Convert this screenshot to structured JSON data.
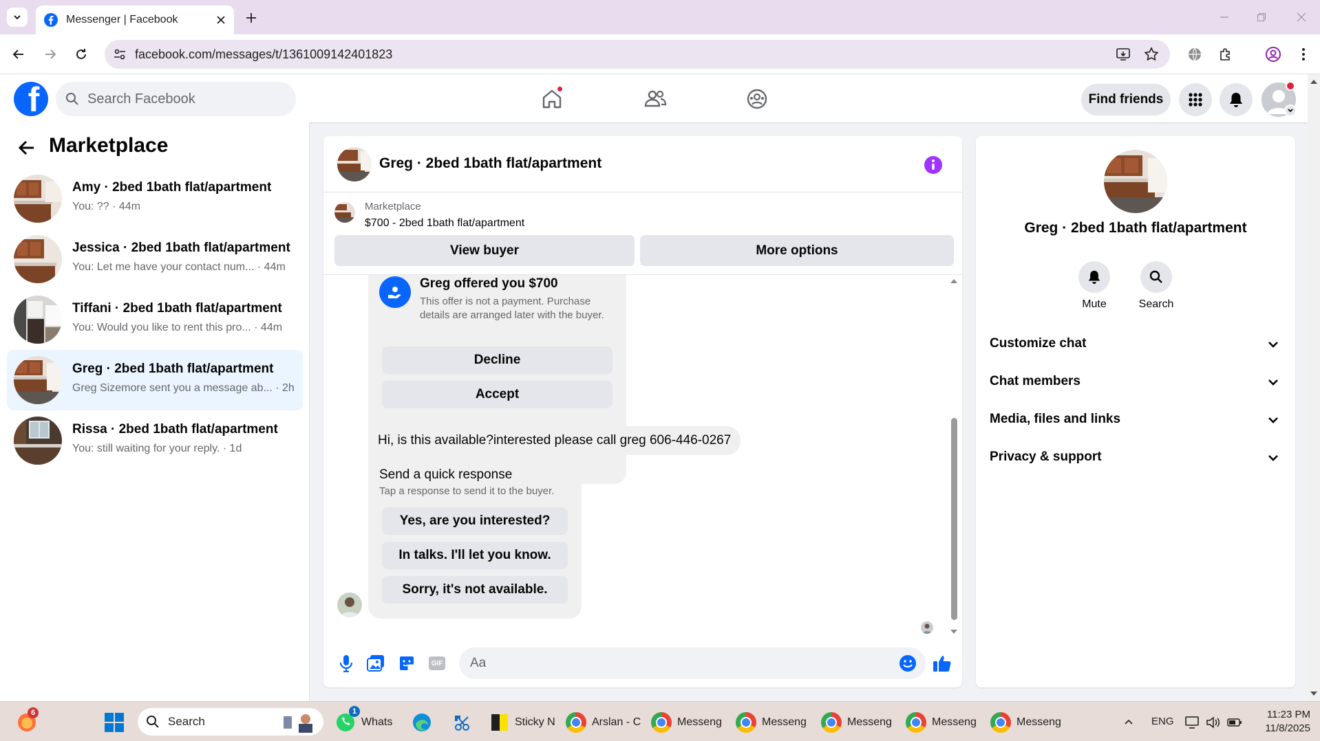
{
  "browser": {
    "tab_title": "Messenger | Facebook",
    "url": "facebook.com/messages/t/1361009142401823"
  },
  "header": {
    "search_placeholder": "Search Facebook",
    "find_friends_label": "Find friends"
  },
  "sidebar": {
    "title": "Marketplace",
    "conversations": [
      {
        "name": "Amy · 2bed 1bath flat/apartment",
        "preview": "You: ?? · 44m",
        "active": false
      },
      {
        "name": "Jessica · 2bed 1bath flat/apartment",
        "preview": "You: Let me have your contact num... · 44m",
        "active": false
      },
      {
        "name": "Tiffani · 2bed 1bath flat/apartment",
        "preview": "You: Would you like to rent this pro... · 44m",
        "active": false
      },
      {
        "name": "Greg · 2bed 1bath flat/apartment",
        "preview": "Greg Sizemore sent you a message ab... · 2h",
        "active": true
      },
      {
        "name": "Rissa · 2bed 1bath flat/apartment",
        "preview": "You: still waiting for your reply. · 1d",
        "active": false
      }
    ]
  },
  "chat": {
    "title": "Greg · 2bed 1bath flat/apartment",
    "listing_label": "Marketplace",
    "listing_price": "$700 - 2bed 1bath flat/apartment",
    "view_buyer_label": "View buyer",
    "more_options_label": "More options",
    "offer": {
      "title": "Greg offered you $700",
      "description": "This offer is not a payment. Purchase details are arranged later with the buyer.",
      "decline_label": "Decline",
      "accept_label": "Accept"
    },
    "message_text": "Hi, is this available?interested please call greg 606-446-0267",
    "quick_response": {
      "title": "Send a quick response",
      "subtitle": "Tap a response to send it to the buyer.",
      "options": [
        "Yes, are you interested?",
        "In talks. I'll let you know.",
        "Sorry, it's not available."
      ]
    },
    "composer_placeholder": "Aa",
    "gif_label": "GIF"
  },
  "details": {
    "name": "Greg · 2bed 1bath flat/apartment",
    "mute_label": "Mute",
    "search_label": "Search",
    "sections": [
      "Customize chat",
      "Chat members",
      "Media, files and links",
      "Privacy & support"
    ]
  },
  "taskbar": {
    "search_label": "Search",
    "apps": [
      {
        "label": "Whats",
        "badge": "1"
      },
      {
        "label": "Sticky N"
      },
      {
        "label": "Arslan - C"
      },
      {
        "label": "Messeng"
      },
      {
        "label": "Messeng"
      },
      {
        "label": "Messeng"
      },
      {
        "label": "Messeng"
      },
      {
        "label": "Messeng"
      }
    ],
    "start_badge": "6",
    "language": "ENG",
    "time": "11:23 PM",
    "date": "11/8/2025"
  },
  "colors": {
    "facebook_blue": "#0866ff",
    "messenger_purple": "#a033ff",
    "notification_red": "#e41e3f",
    "active_row": "#ebf5ff"
  }
}
